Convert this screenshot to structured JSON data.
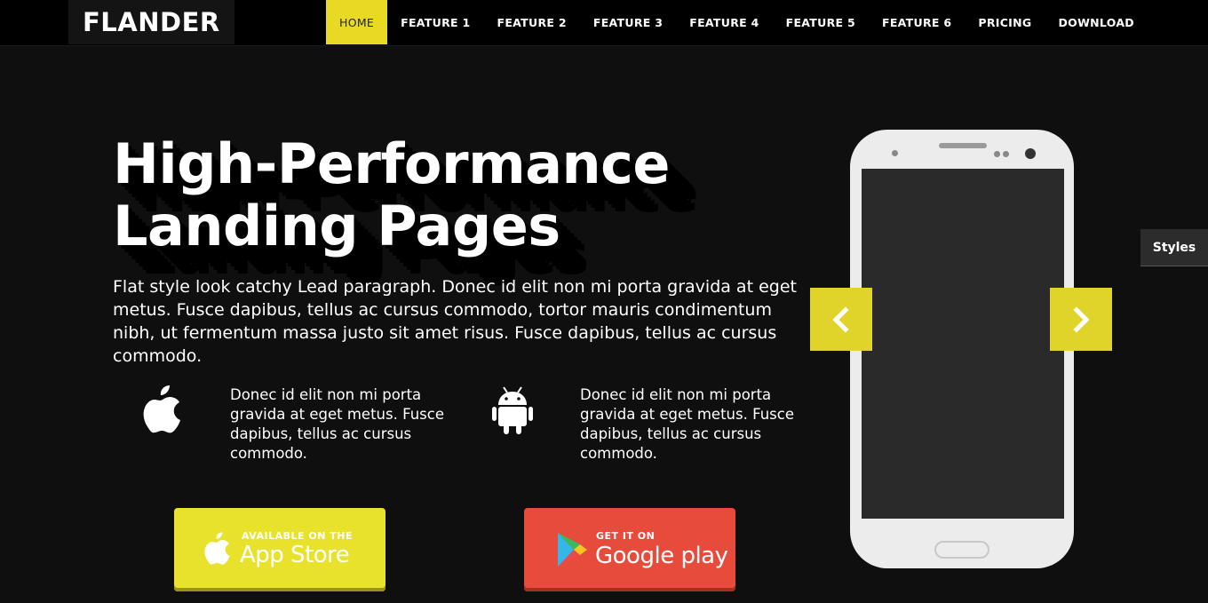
{
  "brand": "FLANDER",
  "nav": {
    "items": [
      {
        "label": "HOME",
        "active": true
      },
      {
        "label": "FEATURE 1"
      },
      {
        "label": "FEATURE 2"
      },
      {
        "label": "FEATURE 3"
      },
      {
        "label": "FEATURE 4"
      },
      {
        "label": "FEATURE 5"
      },
      {
        "label": "FEATURE 6"
      },
      {
        "label": "PRICING"
      },
      {
        "label": "DOWNLOAD"
      }
    ]
  },
  "hero": {
    "title_line1": "High-Performance",
    "title_line2": "Landing Pages",
    "lead": "Flat style look catchy Lead paragraph. Donec id elit non mi porta gravida at eget metus. Fusce dapibus, tellus ac cursus commodo, tortor mauris condimentum nibh, ut fermentum massa justo sit amet risus. Fusce dapibus, tellus ac cursus commodo."
  },
  "features": [
    {
      "icon": "apple-icon",
      "text": "Donec id elit non mi porta gravida at eget metus. Fusce dapibus, tellus ac cursus commodo."
    },
    {
      "icon": "android-icon",
      "text": "Donec id elit non mi porta gravida at eget metus. Fusce dapibus, tellus ac cursus commodo."
    }
  ],
  "buttons": {
    "appstore": {
      "small": "AVAILABLE ON THE",
      "big": "App Store"
    },
    "googleplay": {
      "small": "GET IT ON",
      "big": "Google play"
    }
  },
  "styles_tab": "Styles",
  "colors": {
    "accent": "#e8d924",
    "appstore_button": "#e8e22c",
    "googleplay_button": "#e74b3c",
    "background": "#0f0f0f"
  }
}
